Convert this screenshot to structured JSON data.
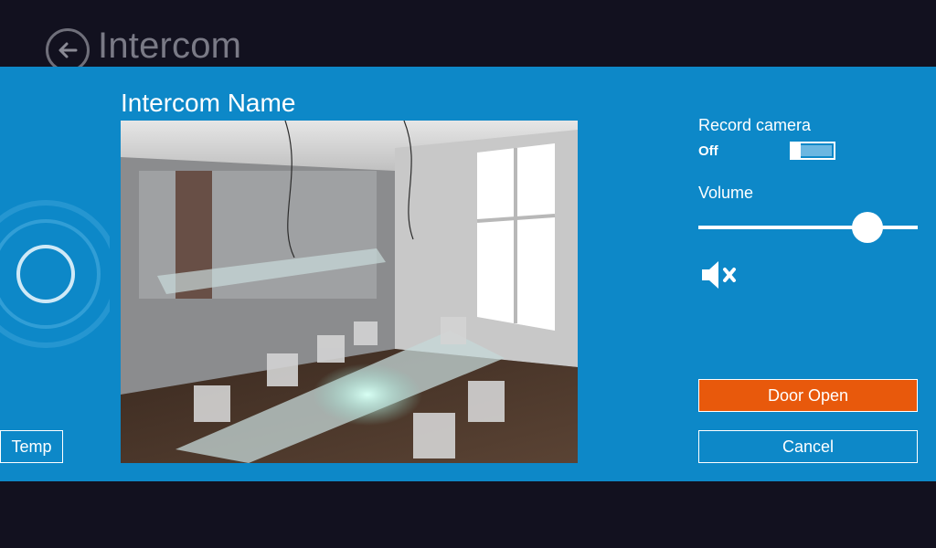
{
  "header": {
    "title": "Intercom",
    "back_icon": "arrow-left-circle-icon"
  },
  "dialog": {
    "intercom_name": "Intercom Name",
    "temp_label": "Temp",
    "record_camera": {
      "label": "Record camera",
      "state": "Off",
      "on": false
    },
    "volume": {
      "label": "Volume",
      "level_fraction": 0.77
    },
    "mute_icon": "speaker-mute-icon",
    "door_open_label": "Door Open",
    "cancel_label": "Cancel"
  },
  "colors": {
    "dialog_bg": "#0d88c8",
    "page_bg": "#12111f",
    "door_open": "#e8590c"
  }
}
